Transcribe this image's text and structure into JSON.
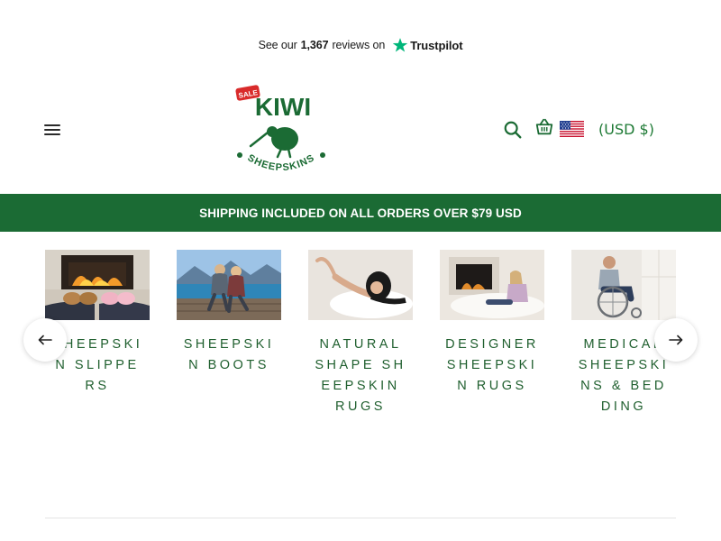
{
  "trustpilot": {
    "prefix": "See our",
    "count": "1,367",
    "suffix": "reviews on",
    "brand": "Trustpilot",
    "star_color": "#00b67a"
  },
  "header": {
    "menu_icon": "hamburger-menu-icon",
    "logo": {
      "sale_badge": "SALE",
      "top_text": "KIWI",
      "bottom_text": "SHEEPSKINS",
      "color": "#1b6b34",
      "badge_color": "#d92b2b"
    },
    "search_icon": "search-icon",
    "cart_icon": "basket-icon",
    "currency": {
      "flag": "us-flag-icon",
      "label": "(USD $)"
    }
  },
  "banner": {
    "text": "SHIPPING INCLUDED ON ALL ORDERS OVER $79 USD",
    "bg_color": "#1b6b34"
  },
  "categories": [
    {
      "label": "SHEEPSKIN SLIPPERS",
      "image": "slippers-by-fireplace"
    },
    {
      "label": "SHEEPSKIN BOOTS",
      "image": "couple-on-lake-dock"
    },
    {
      "label": "NATURAL SHAPE SHEEPSKIN RUGS",
      "image": "woman-on-white-rug"
    },
    {
      "label": "DESIGNER SHEEPSKIN RUGS",
      "image": "woman-by-fireplace-rug"
    },
    {
      "label": "MEDICAL SHEEPSKINS & BEDDING",
      "image": "man-in-wheelchair"
    }
  ],
  "carousel": {
    "prev_icon": "arrow-left-icon",
    "next_icon": "arrow-right-icon"
  },
  "colors": {
    "accent": "#1b6b34",
    "text_green": "#1f5f2e"
  }
}
